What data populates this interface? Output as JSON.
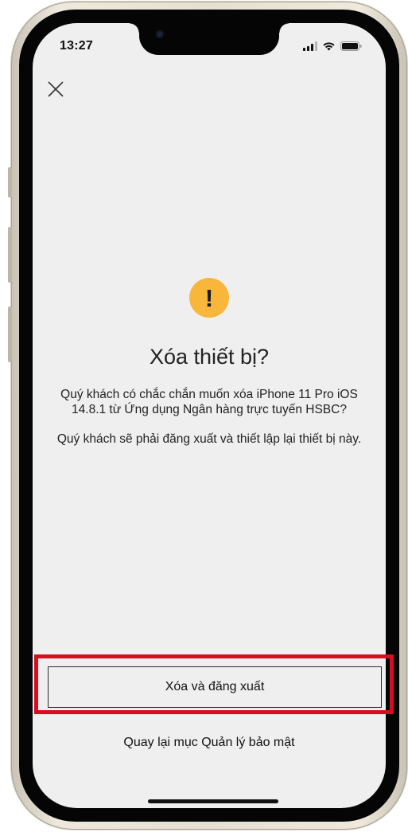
{
  "status_bar": {
    "time": "13:27",
    "icons": [
      "cellular-signal-icon",
      "wifi-icon",
      "battery-icon"
    ]
  },
  "nav": {
    "close_icon": "close-icon"
  },
  "dialog": {
    "icon": "warning-icon",
    "icon_glyph": "!",
    "icon_color": "#f8b63a",
    "title": "Xóa thiết bị?",
    "message_1": "Quý khách có chắc chắn muốn xóa iPhone 11 Pro iOS 14.8.1 từ Ứng dụng Ngân hàng trực tuyến HSBC?",
    "message_2": "Quý khách sẽ phải đăng xuất và thiết lập lại thiết bị này."
  },
  "actions": {
    "primary_label": "Xóa và đăng xuất",
    "secondary_label": "Quay lại mục Quản lý bảo mật",
    "highlight_color": "#d60e20"
  }
}
